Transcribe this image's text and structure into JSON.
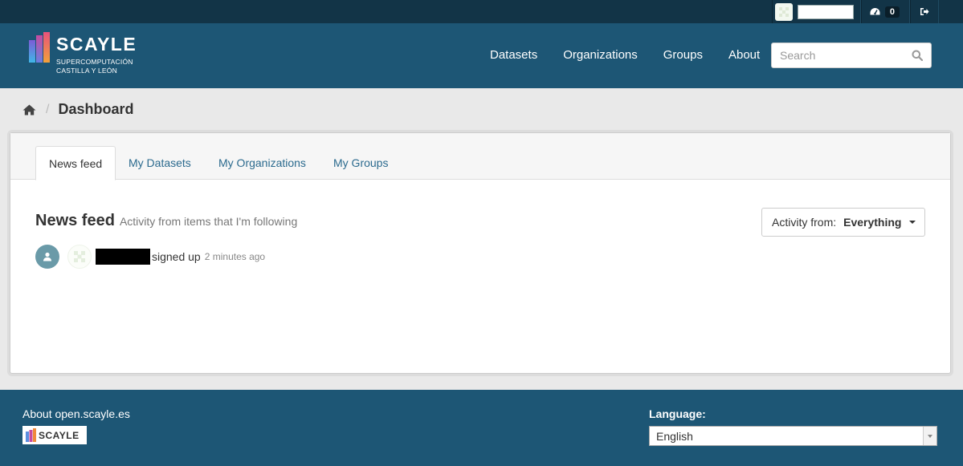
{
  "account": {
    "notification_count": "0"
  },
  "brand": {
    "name": "SCAYLE",
    "subtitle_line1": "SUPERCOMPUTACIÓN",
    "subtitle_line2": "CASTILLA Y LEÓN"
  },
  "nav": {
    "items": [
      "Datasets",
      "Organizations",
      "Groups",
      "About"
    ]
  },
  "search": {
    "placeholder": "Search"
  },
  "breadcrumb": {
    "current": "Dashboard"
  },
  "tabs": [
    "News feed",
    "My Datasets",
    "My Organizations",
    "My Groups"
  ],
  "news_feed": {
    "title": "News feed",
    "subtitle": "Activity from items that I'm following",
    "filter_label": "Activity from:",
    "filter_value": "Everything",
    "activities": [
      {
        "action": "signed up",
        "date": "2 minutes ago"
      }
    ]
  },
  "footer": {
    "about_link": "About open.scayle.es",
    "logo_text": "SCAYLE",
    "language_label": "Language:",
    "language_value": "English"
  },
  "colors": {
    "account_bar": "#123447",
    "masthead": "#1d5675",
    "link": "#2b6a8e",
    "activity_icon": "#6a9aa8"
  }
}
